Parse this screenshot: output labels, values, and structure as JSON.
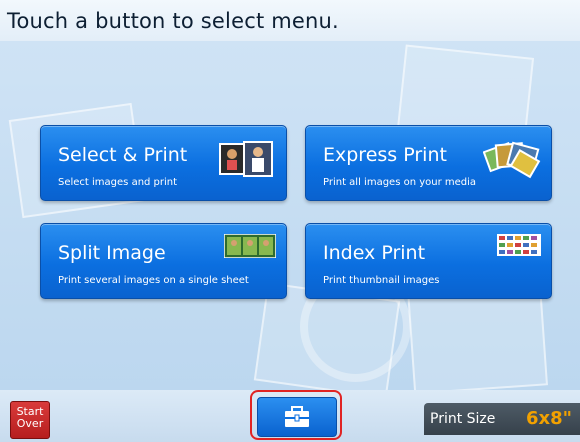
{
  "header": {
    "instruction": "Touch a button to select menu."
  },
  "menu": [
    {
      "title": "Select & Print",
      "subtitle": "Select images and print",
      "icon": "photo-stack-icon"
    },
    {
      "title": "Express Print",
      "subtitle": "Print all images on your media",
      "icon": "photo-fan-icon"
    },
    {
      "title": "Split Image",
      "subtitle": "Print several images on a single sheet",
      "icon": "split-photo-icon"
    },
    {
      "title": "Index Print",
      "subtitle": "Print thumbnail images",
      "icon": "thumbnail-grid-icon"
    }
  ],
  "footer": {
    "start_over": "Start Over",
    "start_over_line1": "Start",
    "start_over_line2": "Over",
    "tools_icon": "toolbox-icon",
    "print_size_label": "Print Size",
    "print_size_value": "6x8\""
  },
  "colors": {
    "accent_blue": "#0b6fe0",
    "start_over_red": "#c82828",
    "print_size_orange": "#f2a100",
    "highlight_red": "#e02424"
  }
}
